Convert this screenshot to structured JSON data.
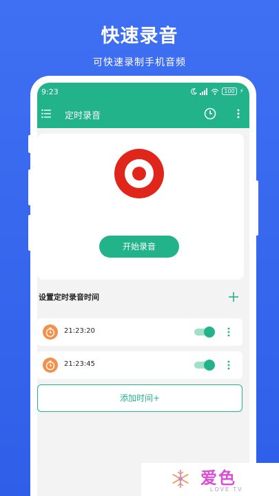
{
  "promo": {
    "title": "快速录音",
    "subtitle": "可快速录制手机音频"
  },
  "status_bar": {
    "time": "9:23",
    "battery": "100"
  },
  "toolbar": {
    "title": "定时录音",
    "menu_icon": "menu-list-icon",
    "history_icon": "clock-icon",
    "more_icon": "more-vertical-icon"
  },
  "record": {
    "icon": "record-icon",
    "start_label": "开始录音"
  },
  "schedule": {
    "section_label": "设置定时录音时间",
    "timers": [
      {
        "time": "21:23:20",
        "enabled": true
      },
      {
        "time": "21:23:45",
        "enabled": true
      }
    ],
    "add_label": "添加时间+"
  },
  "watermark": {
    "text": "爱色",
    "sub": "LOVE TV"
  },
  "colors": {
    "accent": "#22b38a",
    "background": "#3f6ff2",
    "record_red": "#e0261b",
    "timer_orange": "#f2914a"
  }
}
